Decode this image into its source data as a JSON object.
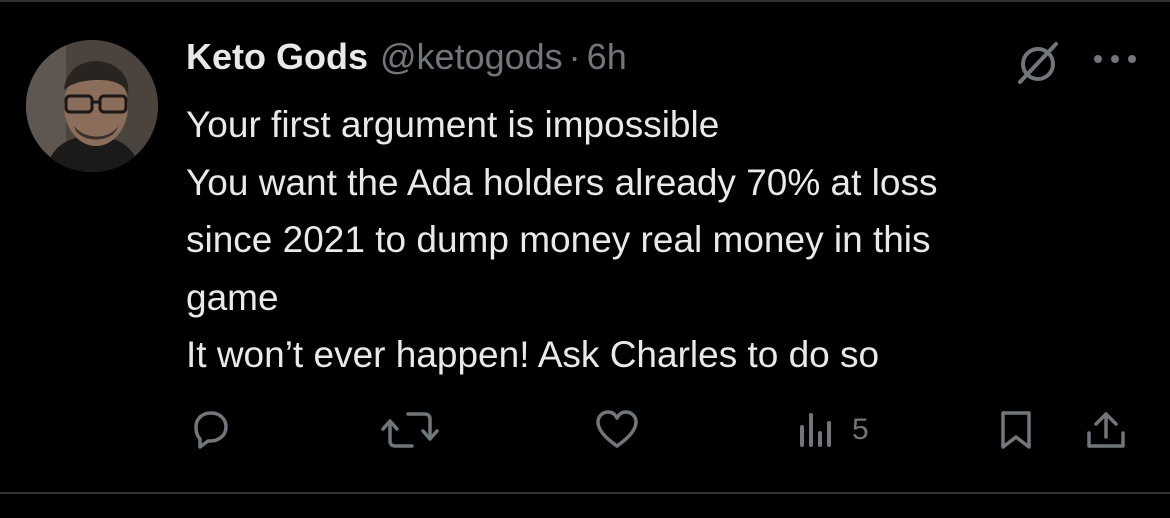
{
  "tweet": {
    "author": {
      "display_name": "Keto Gods",
      "handle": "@ketogods",
      "separator": "·",
      "time": "6h",
      "avatar_icon": "profile-photo"
    },
    "lines": [
      "Your first argument is impossible",
      "You want the Ada holders already 70% at loss",
      "since 2021 to dump money real money in this",
      "game",
      "It won’t ever happen! Ask Charles to do so"
    ],
    "actions": {
      "reply_icon": "reply-icon",
      "retweet_icon": "retweet-icon",
      "like_icon": "heart-icon",
      "views_icon": "views-icon",
      "views_count": "5",
      "bookmark_icon": "bookmark-icon",
      "share_icon": "share-icon"
    },
    "header_icons": {
      "grok_icon": "grok-icon",
      "more_icon": "more-icon"
    }
  },
  "colors": {
    "background": "#000000",
    "text": "#e7e9ea",
    "muted": "#71767b",
    "border": "#2f3336"
  }
}
